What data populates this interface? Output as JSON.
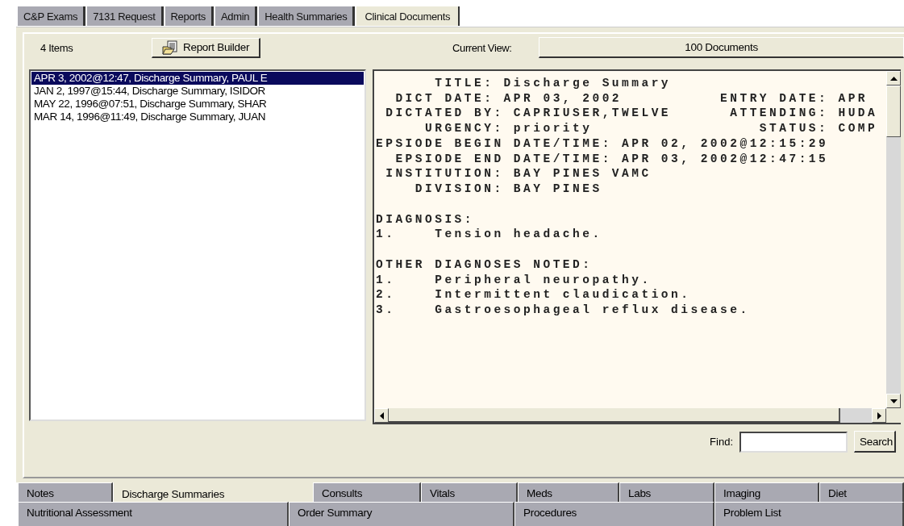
{
  "top_tabs": [
    {
      "label": "C&P Exams",
      "selected": false
    },
    {
      "label": "7131 Request",
      "selected": false
    },
    {
      "label": "Reports",
      "selected": false
    },
    {
      "label": "Admin",
      "selected": false
    },
    {
      "label": "Health Summaries",
      "selected": false
    },
    {
      "label": "Clinical Documents",
      "selected": true
    }
  ],
  "toolbar": {
    "item_count": "4 Items",
    "report_builder_button": "Report Builder",
    "current_view_label": "Current View:",
    "current_view_button": "100 Documents"
  },
  "documents": [
    {
      "label": "APR 3, 2002@12:47, Discharge Summary, PAUL E",
      "selected": true
    },
    {
      "label": "JAN 2, 1997@15:44, Discharge Summary, ISIDOR",
      "selected": false
    },
    {
      "label": "MAY 22, 1996@07:51, Discharge Summary, SHAR",
      "selected": false
    },
    {
      "label": "MAR 14, 1996@11:49, Discharge Summary, JUAN",
      "selected": false
    }
  ],
  "report": {
    "sections": [
      [
        "      TITLE: Discharge Summary",
        "  DICT DATE: APR 03, 2002          ENTRY DATE: APR",
        " DICTATED BY: CAPRIUSER,TWELVE      ATTENDING: HUDA",
        "     URGENCY: priority                 STATUS: COMP",
        "EPSIODE BEGIN DATE/TIME: APR 02, 2002@12:15:29",
        "  EPSIODE END DATE/TIME: APR 03, 2002@12:47:15",
        " INSTITUTION: BAY PINES VAMC",
        "    DIVISION: BAY PINES"
      ],
      [
        "DIAGNOSIS:",
        "1.    Tension headache."
      ],
      [
        "OTHER DIAGNOSES NOTED:",
        "1.    Peripheral neuropathy.",
        "2.    Intermittent claudication.",
        "3.    Gastroesophageal reflux disease."
      ]
    ]
  },
  "find": {
    "label": "Find:",
    "button": "Search"
  },
  "bottom_tabs": [
    [
      {
        "label": "Notes",
        "selected": false
      },
      {
        "label": "Discharge Summaries",
        "selected": true
      },
      {
        "label": "Consults",
        "selected": false
      },
      {
        "label": "Vitals",
        "selected": false
      },
      {
        "label": "Meds",
        "selected": false
      },
      {
        "label": "Labs",
        "selected": false
      },
      {
        "label": "Imaging",
        "selected": false
      },
      {
        "label": "Diet",
        "selected": false
      }
    ],
    [
      {
        "label": "Nutritional Assessment",
        "selected": false
      },
      {
        "label": "Order Summary",
        "selected": false
      },
      {
        "label": "Procedures",
        "selected": false
      },
      {
        "label": "Problem List",
        "selected": false
      }
    ]
  ]
}
